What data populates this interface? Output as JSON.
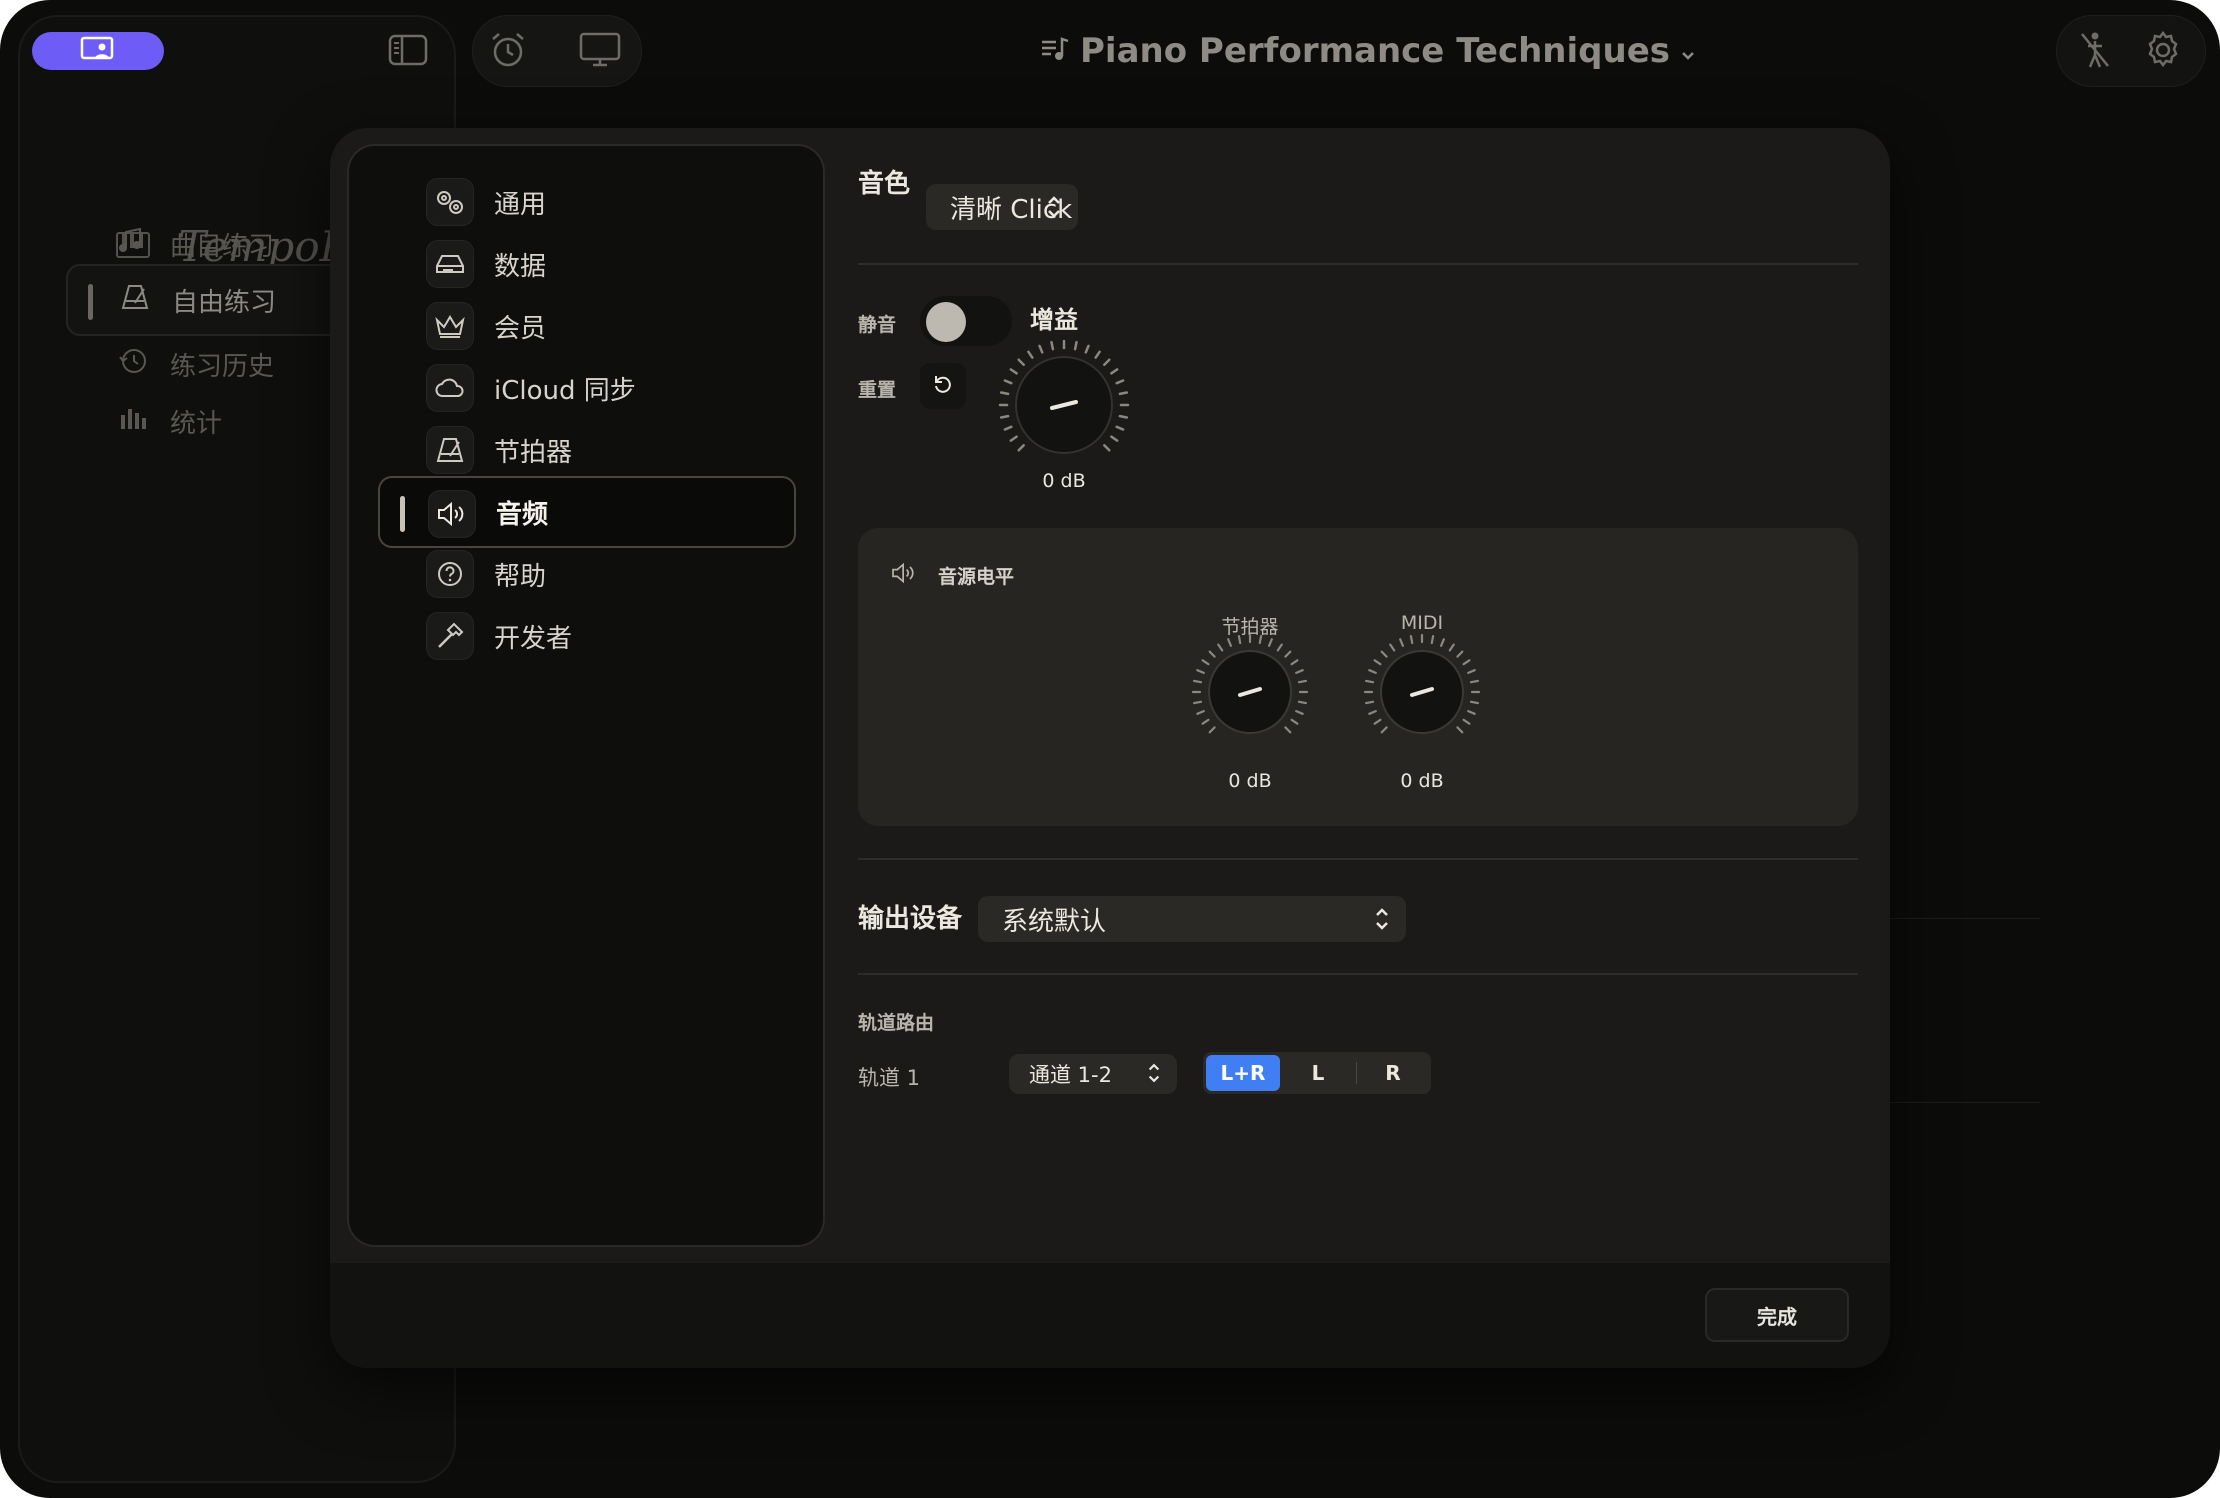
{
  "window": {
    "title": "Piano Performance Techniques",
    "title_icon": "music-list-icon",
    "accent": "#6d5cf5"
  },
  "sidebar": {
    "brand": "TempoPro",
    "items": [
      {
        "label": "曲目练习",
        "icon": "music-notes-icon"
      },
      {
        "label": "自由练习",
        "icon": "metronome-icon",
        "active": true
      },
      {
        "label": "练习历史",
        "icon": "history-icon"
      },
      {
        "label": "统计",
        "icon": "bar-chart-icon"
      }
    ]
  },
  "settings_menu": {
    "items": [
      {
        "label": "通用",
        "icon": "gears-icon"
      },
      {
        "label": "数据",
        "icon": "drive-icon"
      },
      {
        "label": "会员",
        "icon": "crown-icon"
      },
      {
        "label": "iCloud 同步",
        "icon": "cloud-icon"
      },
      {
        "label": "节拍器",
        "icon": "metronome-icon"
      },
      {
        "label": "音频",
        "icon": "speaker-icon",
        "active": true
      },
      {
        "label": "帮助",
        "icon": "help-icon"
      },
      {
        "label": "开发者",
        "icon": "hammer-icon"
      }
    ]
  },
  "audio": {
    "timbre_label": "音色",
    "timbre_value": "清晰 Click",
    "mute_label": "静音",
    "mute_on": false,
    "reset_label": "重置",
    "gain_label": "增益",
    "gain_value": "0 dB",
    "levels_title": "音源电平",
    "metronome_label": "节拍器",
    "metronome_value": "0 dB",
    "midi_label": "MIDI",
    "midi_value": "0 dB",
    "output_label": "输出设备",
    "output_value": "系统默认",
    "routing_title": "轨道路由",
    "track_label": "轨道 1",
    "channel_value": "通道 1-2",
    "pan_options": [
      "L+R",
      "L",
      "R"
    ],
    "pan_selected": "L+R",
    "selected_color": "#3f7ef3"
  },
  "footer": {
    "done_label": "完成"
  }
}
